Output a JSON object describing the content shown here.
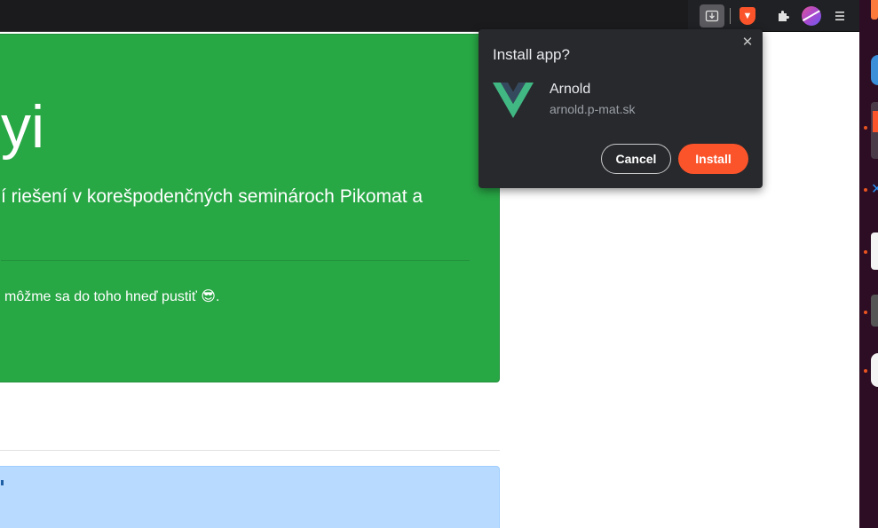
{
  "toolbar": {
    "icons": [
      "install-app-icon",
      "brave-shield-icon",
      "extensions-icon",
      "profile-avatar",
      "menu-icon"
    ]
  },
  "hero": {
    "title": "yi",
    "lead": "í riešení v korešpodenčných seminároch Pikomat a",
    "text": "môžme sa do toho hneď pustiť 😎."
  },
  "popup": {
    "title": "Install app?",
    "close_symbol": "✕",
    "app_name": "Arnold",
    "app_url": "arnold.p-mat.sk",
    "cancel_label": "Cancel",
    "install_label": "Install"
  },
  "colors": {
    "hero_bg": "#28a745",
    "card_bg": "#b8daff",
    "popup_bg": "#28292d",
    "install_btn": "#fb542b",
    "vue_green": "#41b883",
    "vue_dark": "#35495e"
  }
}
